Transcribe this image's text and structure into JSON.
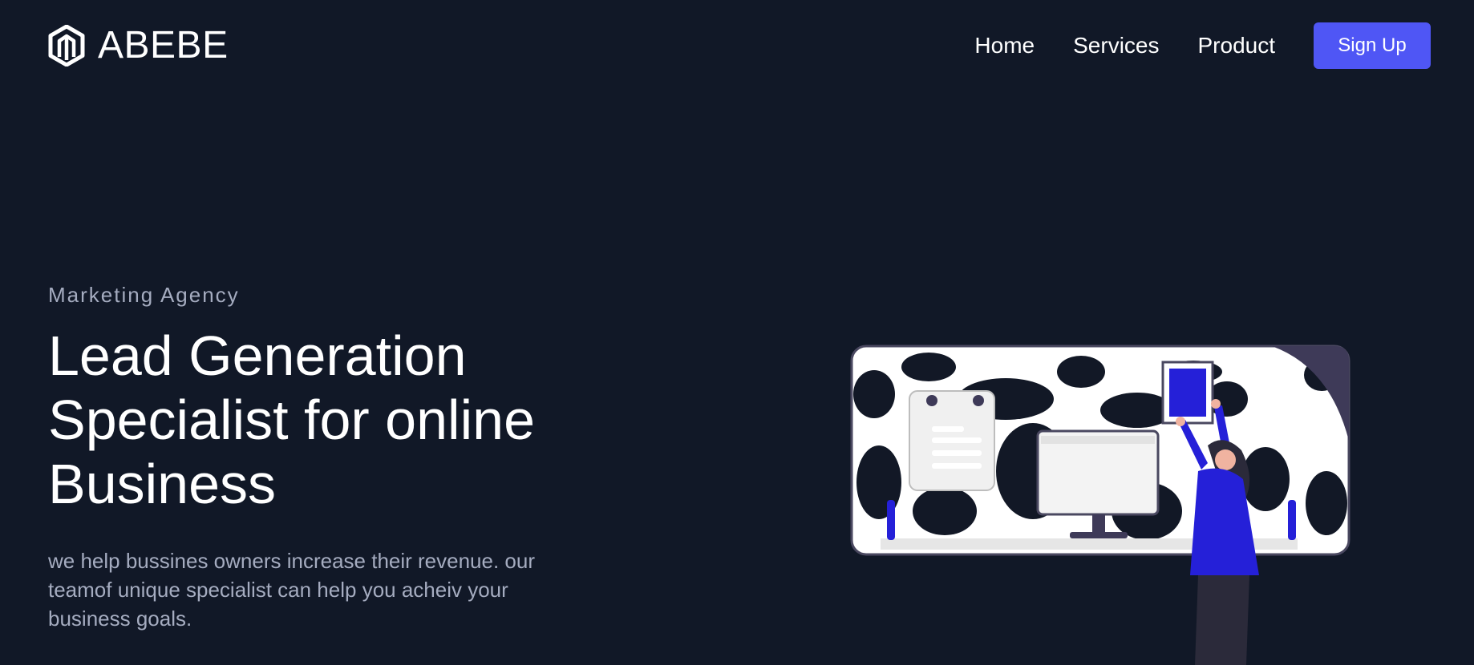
{
  "brand": {
    "name": "ABEBE",
    "logo_icon": "hexagon-logo-icon"
  },
  "nav": {
    "links": [
      {
        "label": "Home"
      },
      {
        "label": "Services"
      },
      {
        "label": "Product"
      }
    ],
    "signup_label": "Sign Up"
  },
  "hero": {
    "eyebrow": "Marketing Agency",
    "headline": "Lead Generation Specialist for online Business",
    "subtext": "we help bussines owners increase their revenue. our teamof unique specialist can help you acheiv your business goals."
  },
  "colors": {
    "background": "#111827",
    "accent": "#4f56f5",
    "muted_text": "#a5acc0",
    "illustration_accent": "#2520d8"
  }
}
